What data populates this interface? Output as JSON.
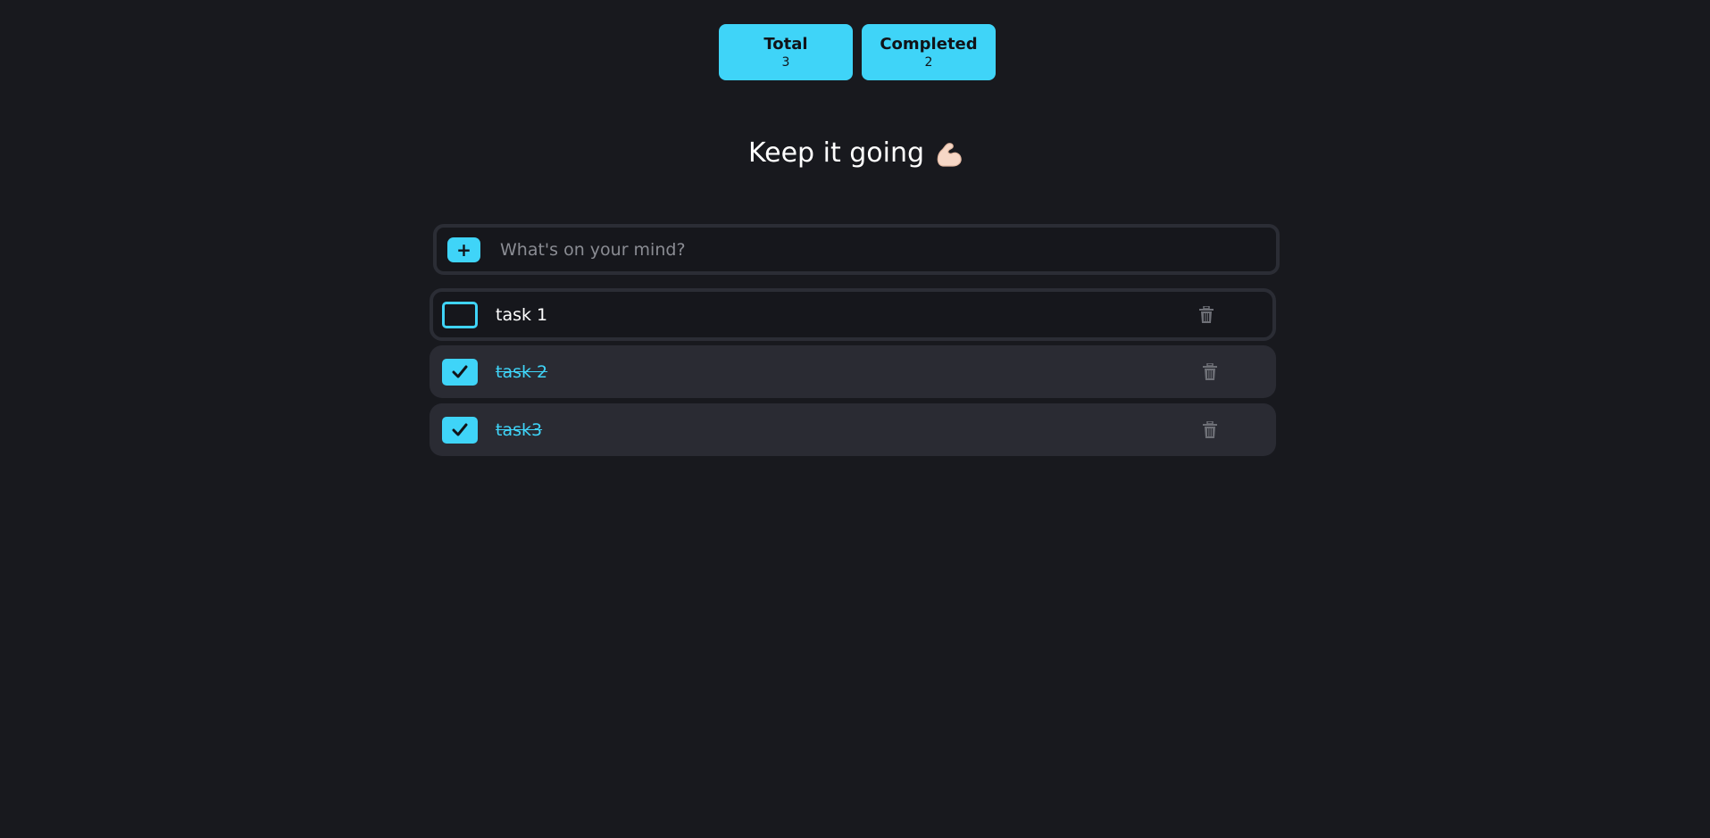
{
  "stats": {
    "total": {
      "label": "Total",
      "value": "3"
    },
    "completed": {
      "label": "Completed",
      "value": "2"
    }
  },
  "headline": {
    "text": "Keep it going",
    "emoji_icon": "flexed-biceps-icon"
  },
  "input": {
    "add_label": "+",
    "placeholder": "What's on your mind?",
    "value": ""
  },
  "tasks": [
    {
      "label": "task 1",
      "completed": false
    },
    {
      "label": "task 2",
      "completed": true
    },
    {
      "label": "task3",
      "completed": true
    }
  ],
  "colors": {
    "background": "#18191e",
    "accent": "#3fd4f8",
    "card": "#2a2b33",
    "border": "#2b2d35",
    "muted": "#8a8c93"
  }
}
